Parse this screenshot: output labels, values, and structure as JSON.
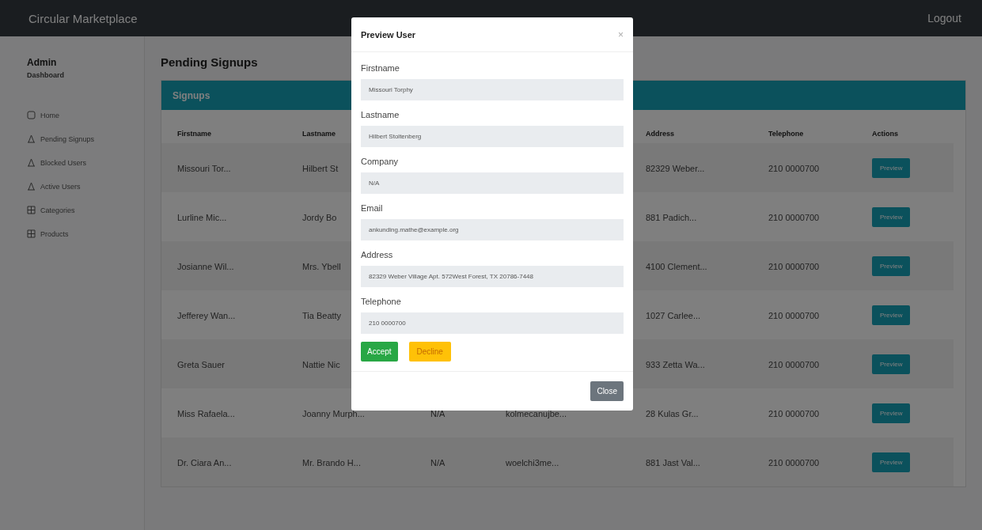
{
  "navbar": {
    "brand": "Circular Marketplace",
    "logout": "Logout"
  },
  "sidebar": {
    "title": "Admin",
    "subtitle": "Dashboard",
    "items": [
      {
        "label": "Home"
      },
      {
        "label": "Pending Signups"
      },
      {
        "label": "Blocked Users"
      },
      {
        "label": "Active Users"
      },
      {
        "label": "Categories"
      },
      {
        "label": "Products"
      }
    ]
  },
  "page_title": "Pending Signups",
  "card": {
    "title": "Signups",
    "table": {
      "columns": [
        "Firstname",
        "Lastname",
        null,
        null,
        "Address",
        "Telephone",
        "Actions"
      ],
      "rows": [
        {
          "cells": [
            "Missouri Tor...",
            "Hilbert St",
            null,
            null,
            "82329 Weber...",
            "210 0000700"
          ],
          "action": "Preview"
        },
        {
          "cells": [
            "Lurline Mic...",
            "Jordy Bo",
            null,
            null,
            "881 Padich...",
            "210 0000700"
          ],
          "action": "Preview"
        },
        {
          "cells": [
            "Josianne Wil...",
            "Mrs. Ybell",
            null,
            null,
            "4100 Clement...",
            "210 0000700"
          ],
          "action": "Preview"
        },
        {
          "cells": [
            "Jefferey Wan...",
            "Tia Beatty",
            null,
            null,
            "1027 Carlee...",
            "210 0000700"
          ],
          "action": "Preview"
        },
        {
          "cells": [
            "Greta Sauer",
            "Nattie Nic",
            null,
            null,
            "933 Zetta Wa...",
            "210 0000700"
          ],
          "action": "Preview"
        },
        {
          "cells": [
            "Miss Rafaela...",
            "Joanny Murph...",
            "N/A",
            "kolmecanujbe...",
            "28 Kulas Gr...",
            "210 0000700"
          ],
          "action": "Preview"
        },
        {
          "cells": [
            "Dr. Ciara An...",
            "Mr. Brando H...",
            "N/A",
            "woelchi3me...",
            "881 Jast Val...",
            "210 0000700"
          ],
          "action": "Preview"
        }
      ]
    }
  },
  "modal": {
    "title": "Preview User",
    "close_icon": "×",
    "fields": [
      {
        "label": "Firstname",
        "value": "Missouri Torphy"
      },
      {
        "label": "Lastname",
        "value": "Hilbert Stoltenberg"
      },
      {
        "label": "Company",
        "value": "N/A"
      },
      {
        "label": "Email",
        "value": "ankunding.mathe@example.org"
      },
      {
        "label": "Address",
        "value": "82329 Weber Village Apt. 572West Forest, TX 20786-7448"
      },
      {
        "label": "Telephone",
        "value": "210 0000700"
      }
    ],
    "actions": [
      {
        "kind": "accept",
        "label": "Accept"
      },
      {
        "kind": "decline",
        "label": "Decline"
      }
    ],
    "footer_button": "Close"
  }
}
